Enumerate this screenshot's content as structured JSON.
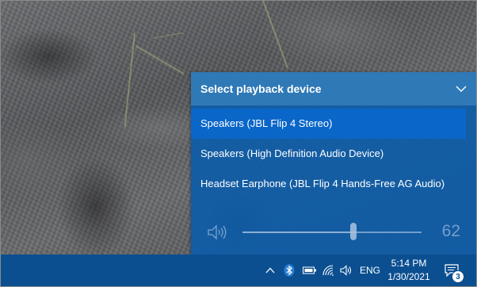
{
  "flyout": {
    "title": "Select playback device",
    "devices": [
      {
        "label": "Speakers (JBL Flip 4 Stereo)",
        "selected": true
      },
      {
        "label": "Speakers (High Definition Audio Device)",
        "selected": false
      },
      {
        "label": "Headset Earphone (JBL Flip 4 Hands-Free AG Audio)",
        "selected": false
      }
    ],
    "volume": {
      "value": "62",
      "fraction": 0.62
    }
  },
  "taskbar": {
    "language": "ENG",
    "time": "5:14 PM",
    "date": "1/30/2021",
    "notification_count": "3"
  },
  "colors": {
    "flyout_background": "#0e5ca8",
    "header_background": "#2f79b7",
    "selected_device": "#0a66c8",
    "taskbar": "#0b4f91"
  },
  "icons": {
    "collapse": "chevron-down-icon",
    "volume": "speaker-icon",
    "tray": [
      "chevron-up-icon",
      "bluetooth-icon",
      "battery-icon",
      "wifi-icon",
      "volume-icon",
      "notification-icon"
    ]
  }
}
